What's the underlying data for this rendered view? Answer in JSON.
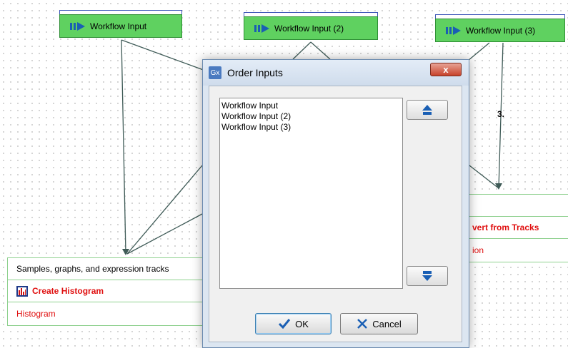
{
  "workflow_inputs": [
    {
      "label": "Workflow Input"
    },
    {
      "label": "Workflow Input (2)"
    },
    {
      "label": "Workflow Input (3)"
    }
  ],
  "annotation": "3.",
  "left_tool": {
    "input_label": "Samples, graphs, and expression tracks",
    "tool_name": "Create Histogram",
    "output_label": "Histogram"
  },
  "right_tool": {
    "tool_name_partial": "vert from Tracks",
    "output_partial": "ion"
  },
  "dialog": {
    "icon_text": "Gx",
    "title": "Order Inputs",
    "close_glyph": "x",
    "items": [
      "Workflow Input",
      "Workflow Input (2)",
      "Workflow Input (3)"
    ],
    "ok_label": "OK",
    "cancel_label": "Cancel"
  },
  "colors": {
    "node_green": "#5fd160",
    "tool_red": "#e01010",
    "arrow_blue": "#1a5fb4"
  }
}
